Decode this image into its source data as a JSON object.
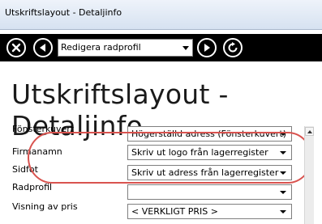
{
  "window": {
    "title": "Utskriftslayout - Detaljinfo"
  },
  "toolbar": {
    "selector_value": "Redigera radprofil"
  },
  "page_title": "Utskriftslayout - Detaljinfo",
  "fields": [
    {
      "label": "Fönsterkuvert",
      "value": "Högerställd adress (Fönsterkuvert)"
    },
    {
      "label": "Firmanamn",
      "value": "Skriv ut logo från lagerregister"
    },
    {
      "label": "Sidfot",
      "value": "Skriv ut adress från lagerregister"
    },
    {
      "label": "Radprofil",
      "value": ""
    },
    {
      "label": "Visning av pris",
      "value": "< VERKLIGT PRIS >"
    }
  ],
  "colors": {
    "toolbar": "#000000",
    "highlight": "#d9534f",
    "titlebar": "#d6e2f1"
  }
}
